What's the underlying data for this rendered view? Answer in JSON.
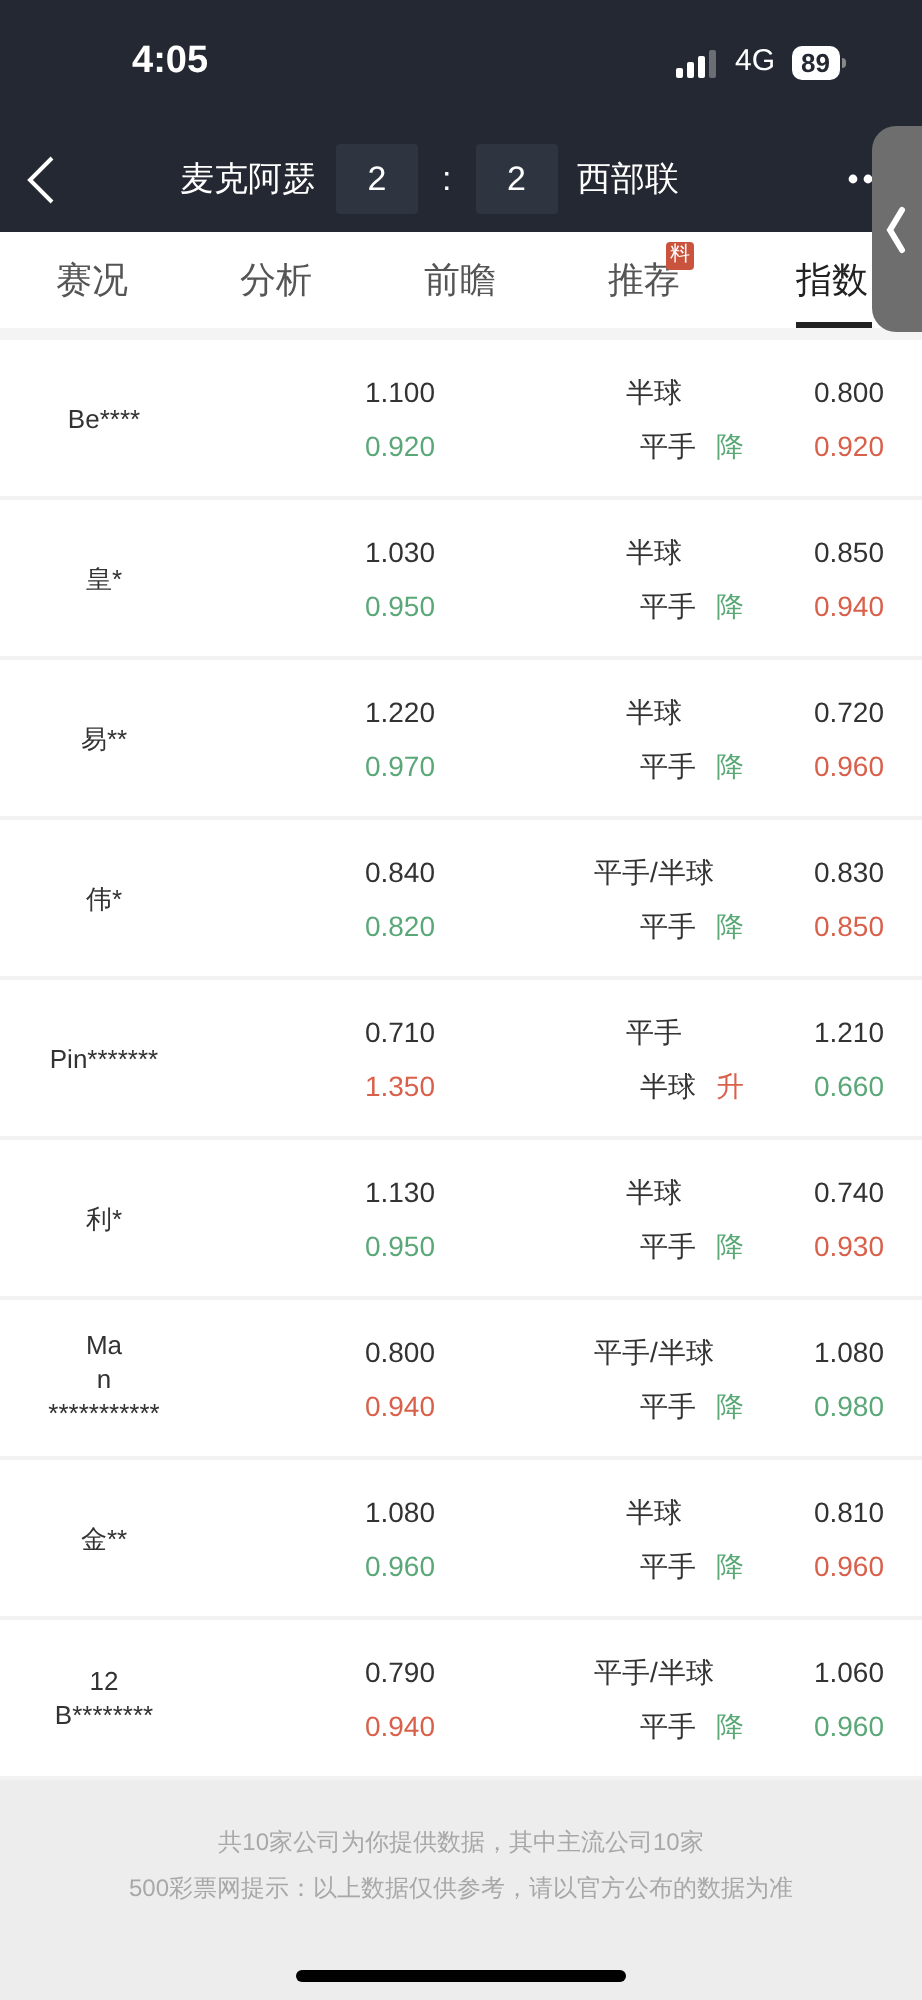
{
  "status_bar": {
    "time": "4:05",
    "network": "4G",
    "battery": "89"
  },
  "header": {
    "home_team": "麦克阿瑟",
    "home_score": "2",
    "separator": ":",
    "away_score": "2",
    "away_team": "西部联"
  },
  "tabs": [
    {
      "label": "赛况",
      "selected": false
    },
    {
      "label": "分析",
      "selected": false
    },
    {
      "label": "前瞻",
      "selected": false
    },
    {
      "label": "推荐",
      "selected": false,
      "badge": "料"
    },
    {
      "label": "指数",
      "selected": true
    }
  ],
  "rows": [
    {
      "company": [
        "Be****"
      ],
      "open": {
        "home": {
          "value": "1.100"
        },
        "line": "半球",
        "away": {
          "value": "0.800"
        }
      },
      "live": {
        "home": {
          "value": "0.920",
          "kind": "down"
        },
        "line": "平手",
        "move": {
          "text": "降",
          "kind": "down"
        },
        "away": {
          "value": "0.920",
          "kind": "up"
        }
      }
    },
    {
      "company": [
        "皇*"
      ],
      "open": {
        "home": {
          "value": "1.030"
        },
        "line": "半球",
        "away": {
          "value": "0.850"
        }
      },
      "live": {
        "home": {
          "value": "0.950",
          "kind": "down"
        },
        "line": "平手",
        "move": {
          "text": "降",
          "kind": "down"
        },
        "away": {
          "value": "0.940",
          "kind": "up"
        }
      }
    },
    {
      "company": [
        "易**"
      ],
      "open": {
        "home": {
          "value": "1.220"
        },
        "line": "半球",
        "away": {
          "value": "0.720"
        }
      },
      "live": {
        "home": {
          "value": "0.970",
          "kind": "down"
        },
        "line": "平手",
        "move": {
          "text": "降",
          "kind": "down"
        },
        "away": {
          "value": "0.960",
          "kind": "up"
        }
      }
    },
    {
      "company": [
        "伟*"
      ],
      "open": {
        "home": {
          "value": "0.840"
        },
        "line": "平手/半球",
        "away": {
          "value": "0.830"
        }
      },
      "live": {
        "home": {
          "value": "0.820",
          "kind": "down"
        },
        "line": "平手",
        "move": {
          "text": "降",
          "kind": "down"
        },
        "away": {
          "value": "0.850",
          "kind": "up"
        }
      }
    },
    {
      "company": [
        "Pin*******"
      ],
      "open": {
        "home": {
          "value": "0.710"
        },
        "line": "平手",
        "away": {
          "value": "1.210"
        }
      },
      "live": {
        "home": {
          "value": "1.350",
          "kind": "up"
        },
        "line": "半球",
        "move": {
          "text": "升",
          "kind": "up"
        },
        "away": {
          "value": "0.660",
          "kind": "down"
        }
      }
    },
    {
      "company": [
        "利*"
      ],
      "open": {
        "home": {
          "value": "1.130"
        },
        "line": "半球",
        "away": {
          "value": "0.740"
        }
      },
      "live": {
        "home": {
          "value": "0.950",
          "kind": "down"
        },
        "line": "平手",
        "move": {
          "text": "降",
          "kind": "down"
        },
        "away": {
          "value": "0.930",
          "kind": "up"
        }
      }
    },
    {
      "company": [
        "Ma",
        "n",
        "***********"
      ],
      "open": {
        "home": {
          "value": "0.800"
        },
        "line": "平手/半球",
        "away": {
          "value": "1.080"
        }
      },
      "live": {
        "home": {
          "value": "0.940",
          "kind": "up"
        },
        "line": "平手",
        "move": {
          "text": "降",
          "kind": "down"
        },
        "away": {
          "value": "0.980",
          "kind": "down"
        }
      }
    },
    {
      "company": [
        "金**"
      ],
      "open": {
        "home": {
          "value": "1.080"
        },
        "line": "半球",
        "away": {
          "value": "0.810"
        }
      },
      "live": {
        "home": {
          "value": "0.960",
          "kind": "down"
        },
        "line": "平手",
        "move": {
          "text": "降",
          "kind": "down"
        },
        "away": {
          "value": "0.960",
          "kind": "up"
        }
      }
    },
    {
      "company": [
        "12",
        "B********"
      ],
      "open": {
        "home": {
          "value": "0.790"
        },
        "line": "平手/半球",
        "away": {
          "value": "1.060"
        }
      },
      "live": {
        "home": {
          "value": "0.940",
          "kind": "up"
        },
        "line": "平手",
        "move": {
          "text": "降",
          "kind": "down"
        },
        "away": {
          "value": "0.960",
          "kind": "down"
        }
      }
    }
  ],
  "footer": {
    "lines": [
      "共10家公司为你提供数据，其中主流公司10家",
      "500彩票网提示：以上数据仅供参考，请以官方公布的数据为准"
    ]
  }
}
